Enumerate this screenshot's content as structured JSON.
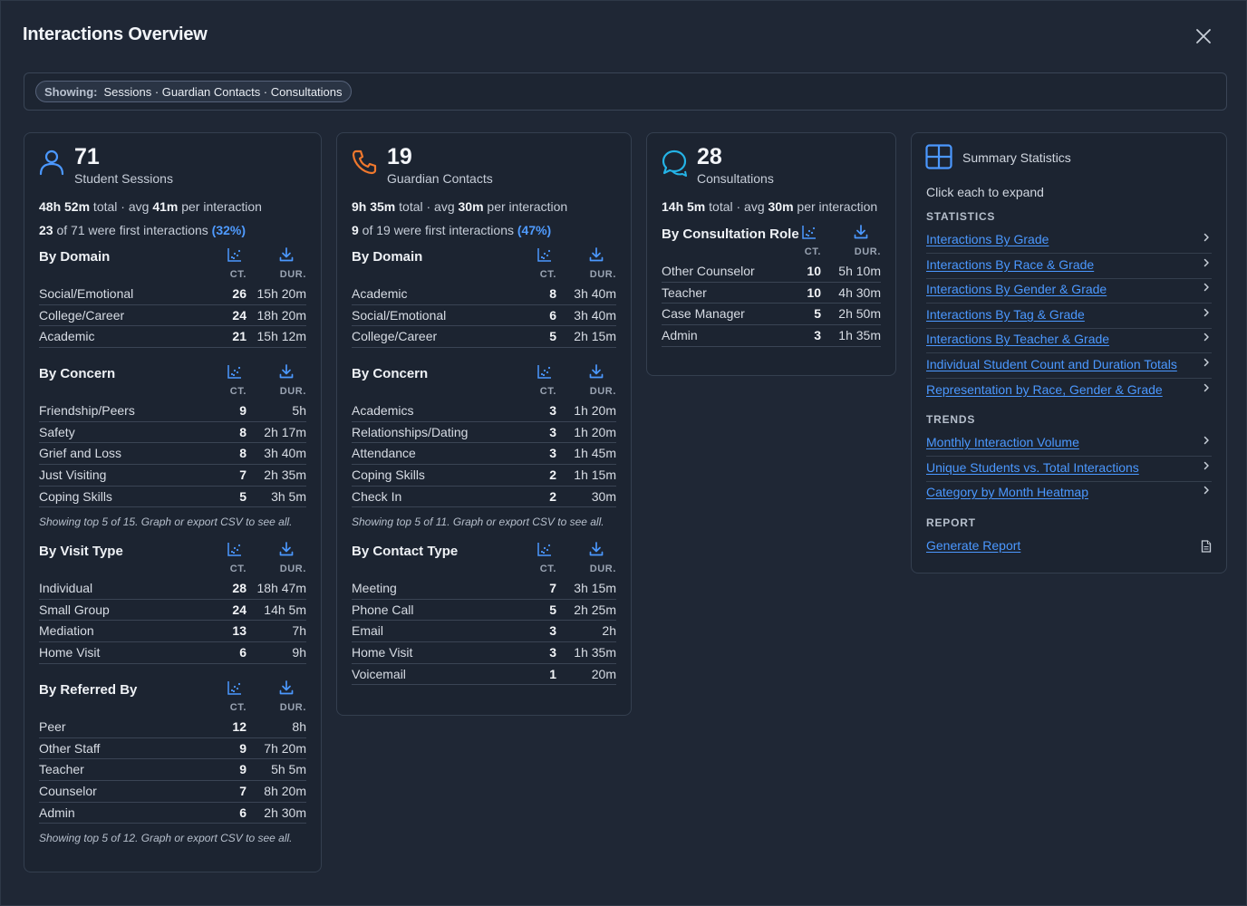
{
  "header": {
    "title": "Interactions Overview"
  },
  "filter": {
    "label": "Showing:",
    "value": "Sessions · Guardian Contacts · Consultations"
  },
  "columns": {
    "ct": "CT.",
    "dur": "DUR."
  },
  "sessions": {
    "count": "71",
    "label": "Student Sessions",
    "total": "48h 52m",
    "total_suffix": " total · avg ",
    "avg": "41m",
    "avg_suffix": " per interaction",
    "first": "23",
    "first_mid": " of 71 were first interactions ",
    "first_pct": "(32%)",
    "sections": [
      {
        "title": "By Domain",
        "rows": [
          {
            "name": "Social/Emotional",
            "ct": "26",
            "dur": "15h 20m"
          },
          {
            "name": "College/Career",
            "ct": "24",
            "dur": "18h 20m"
          },
          {
            "name": "Academic",
            "ct": "21",
            "dur": "15h 12m"
          }
        ]
      },
      {
        "title": "By Concern",
        "rows": [
          {
            "name": "Friendship/Peers",
            "ct": "9",
            "dur": "5h"
          },
          {
            "name": "Safety",
            "ct": "8",
            "dur": "2h 17m"
          },
          {
            "name": "Grief and Loss",
            "ct": "8",
            "dur": "3h 40m"
          },
          {
            "name": "Just Visiting",
            "ct": "7",
            "dur": "2h 35m"
          },
          {
            "name": "Coping Skills",
            "ct": "5",
            "dur": "3h 5m"
          }
        ],
        "note": "Showing top 5 of 15. Graph or export CSV to see all."
      },
      {
        "title": "By Visit Type",
        "rows": [
          {
            "name": "Individual",
            "ct": "28",
            "dur": "18h 47m"
          },
          {
            "name": "Small Group",
            "ct": "24",
            "dur": "14h 5m"
          },
          {
            "name": "Mediation",
            "ct": "13",
            "dur": "7h"
          },
          {
            "name": "Home Visit",
            "ct": "6",
            "dur": "9h"
          }
        ]
      },
      {
        "title": "By Referred By",
        "rows": [
          {
            "name": "Peer",
            "ct": "12",
            "dur": "8h"
          },
          {
            "name": "Other Staff",
            "ct": "9",
            "dur": "7h 20m"
          },
          {
            "name": "Teacher",
            "ct": "9",
            "dur": "5h 5m"
          },
          {
            "name": "Counselor",
            "ct": "7",
            "dur": "8h 20m"
          },
          {
            "name": "Admin",
            "ct": "6",
            "dur": "2h 30m"
          }
        ],
        "note": "Showing top 5 of 12. Graph or export CSV to see all."
      }
    ]
  },
  "guardian": {
    "count": "19",
    "label": "Guardian Contacts",
    "total": "9h 35m",
    "total_suffix": " total · avg ",
    "avg": "30m",
    "avg_suffix": " per interaction",
    "first": "9",
    "first_mid": " of 19 were first interactions ",
    "first_pct": "(47%)",
    "sections": [
      {
        "title": "By Domain",
        "rows": [
          {
            "name": "Academic",
            "ct": "8",
            "dur": "3h 40m"
          },
          {
            "name": "Social/Emotional",
            "ct": "6",
            "dur": "3h 40m"
          },
          {
            "name": "College/Career",
            "ct": "5",
            "dur": "2h 15m"
          }
        ]
      },
      {
        "title": "By Concern",
        "rows": [
          {
            "name": "Academics",
            "ct": "3",
            "dur": "1h 20m"
          },
          {
            "name": "Relationships/Dating",
            "ct": "3",
            "dur": "1h 20m"
          },
          {
            "name": "Attendance",
            "ct": "3",
            "dur": "1h 45m"
          },
          {
            "name": "Coping Skills",
            "ct": "2",
            "dur": "1h 15m"
          },
          {
            "name": "Check In",
            "ct": "2",
            "dur": "30m"
          }
        ],
        "note": "Showing top 5 of 11. Graph or export CSV to see all."
      },
      {
        "title": "By Contact Type",
        "rows": [
          {
            "name": "Meeting",
            "ct": "7",
            "dur": "3h 15m"
          },
          {
            "name": "Phone Call",
            "ct": "5",
            "dur": "2h 25m"
          },
          {
            "name": "Email",
            "ct": "3",
            "dur": "2h"
          },
          {
            "name": "Home Visit",
            "ct": "3",
            "dur": "1h 35m"
          },
          {
            "name": "Voicemail",
            "ct": "1",
            "dur": "20m"
          }
        ]
      }
    ]
  },
  "consult": {
    "count": "28",
    "label": "Consultations",
    "total": "14h 5m",
    "total_suffix": " total · avg ",
    "avg": "30m",
    "avg_suffix": " per interaction",
    "sections": [
      {
        "title": "By Consultation Role",
        "rows": [
          {
            "name": "Other Counselor",
            "ct": "10",
            "dur": "5h 10m"
          },
          {
            "name": "Teacher",
            "ct": "10",
            "dur": "4h 30m"
          },
          {
            "name": "Case Manager",
            "ct": "5",
            "dur": "2h 50m"
          },
          {
            "name": "Admin",
            "ct": "3",
            "dur": "1h 35m"
          }
        ]
      }
    ]
  },
  "summary": {
    "title": "Summary Statistics",
    "hint": "Click each to expand",
    "statistics_label": "STATISTICS",
    "statistics": [
      "Interactions By Grade",
      "Interactions By Race & Grade",
      "Interactions By Gender & Grade",
      "Interactions By Tag & Grade",
      "Interactions By Teacher & Grade",
      "Individual Student Count and Duration Totals",
      "Representation by Race, Gender & Grade"
    ],
    "trends_label": "TRENDS",
    "trends": [
      "Monthly Interaction Volume",
      "Unique Students vs. Total Interactions",
      "Category by Month Heatmap"
    ],
    "report_label": "REPORT",
    "report_link": "Generate Report"
  },
  "icons": {
    "close": "close-icon",
    "person": "person-icon",
    "phone": "phone-icon",
    "chat": "chat-icon",
    "grid": "grid-icon",
    "chart": "scatter-chart-icon",
    "download": "download-icon",
    "chevron": "chevron-right-icon",
    "file": "file-icon"
  },
  "colors": {
    "background": "#1f2735",
    "card": "#1c2431",
    "link": "#4b98ff",
    "person_icon": "#4b98ff",
    "phone_icon": "#f0782d",
    "chat_icon": "#24b3e6"
  }
}
